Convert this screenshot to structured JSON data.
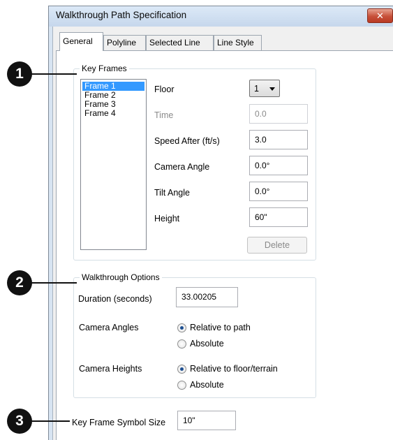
{
  "window": {
    "title": "Walkthrough Path Specification",
    "close_glyph": "✕"
  },
  "tabs": [
    "General",
    "Polyline",
    "Selected Line",
    "Line Style"
  ],
  "key_frames": {
    "group_label": "Key Frames",
    "frames": [
      "Frame 1",
      "Frame 2",
      "Frame 3",
      "Frame 4"
    ],
    "selected_frame": "Frame 1",
    "floor_label": "Floor",
    "floor_value": "1",
    "time_label": "Time",
    "time_value": "0.0",
    "speed_label": "Speed After (ft/s)",
    "speed_value": "3.0",
    "camera_angle_label": "Camera Angle",
    "camera_angle_value": "0.0°",
    "tilt_angle_label": "Tilt Angle",
    "tilt_angle_value": "0.0°",
    "height_label": "Height",
    "height_value": "60\"",
    "delete_label": "Delete"
  },
  "walkthrough_options": {
    "group_label": "Walkthrough Options",
    "duration_label": "Duration (seconds)",
    "duration_value": "33.00205",
    "camera_angles_label": "Camera Angles",
    "camera_angles_options": [
      "Relative to path",
      "Absolute"
    ],
    "camera_angles_selected": "Relative to path",
    "camera_heights_label": "Camera Heights",
    "camera_heights_options": [
      "Relative to floor/terrain",
      "Absolute"
    ],
    "camera_heights_selected": "Relative to floor/terrain"
  },
  "symbol_size": {
    "label": "Key Frame Symbol Size",
    "value": "10\""
  },
  "callouts": [
    "1",
    "2",
    "3"
  ]
}
